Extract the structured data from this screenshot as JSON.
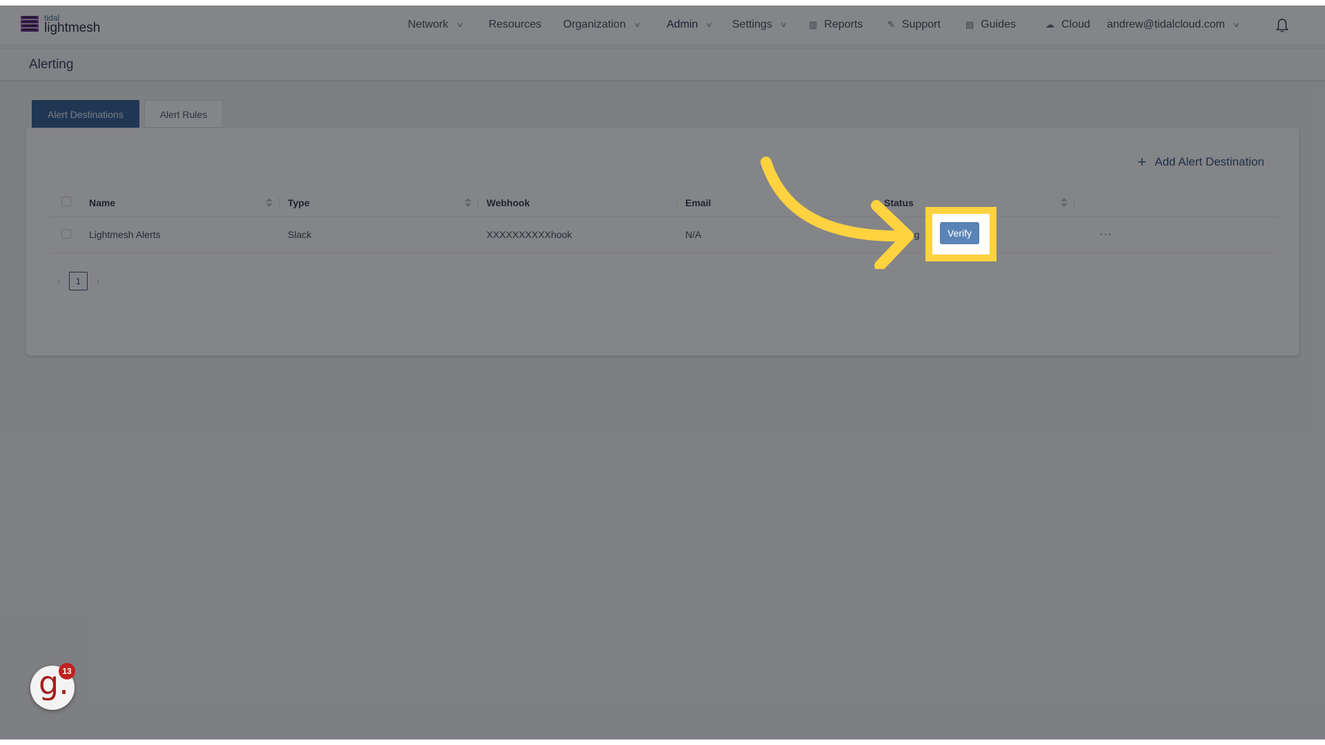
{
  "brand": {
    "top": "tidal",
    "name": "lightmesh"
  },
  "nav": {
    "items": [
      {
        "label": "Network",
        "dropdown": true
      },
      {
        "label": "Resources",
        "dropdown": false
      },
      {
        "label": "Organization",
        "dropdown": true
      },
      {
        "label": "Admin",
        "dropdown": true
      },
      {
        "label": "Settings",
        "dropdown": true
      },
      {
        "label": "Reports",
        "icon": "bar-chart-icon"
      },
      {
        "label": "Support",
        "icon": "wrench-icon"
      },
      {
        "label": "Guides",
        "icon": "book-icon"
      },
      {
        "label": "Cloud",
        "icon": "cloud-icon"
      }
    ],
    "user": "andrew@tidalcloud.com",
    "chevron": "v",
    "icons": {
      "reports": "▥",
      "support": "✎",
      "guides": "▤",
      "cloud": "☁"
    }
  },
  "page": {
    "title": "Alerting"
  },
  "tabs": [
    {
      "label": "Alert Destinations",
      "active": true
    },
    {
      "label": "Alert Rules",
      "active": false
    }
  ],
  "actions": {
    "add_label": "Add Alert Destination",
    "add_icon": "+"
  },
  "table": {
    "columns": [
      "Name",
      "Type",
      "Webhook",
      "Email",
      "Status"
    ],
    "rows": [
      {
        "name": "Lightmesh Alerts",
        "type": "Slack",
        "webhook": "XXXXXXXXXXhook",
        "email": "N/A",
        "status": "Pending",
        "verify_label": "Verify",
        "more": "···"
      }
    ]
  },
  "pagination": {
    "current": "1",
    "prev": "‹",
    "next": "›"
  },
  "highlight": {
    "target": "Verify",
    "color": "#ffd23f"
  },
  "widget": {
    "glyph": "g.",
    "badge": "13"
  },
  "colors": {
    "accent": "#2f5c93",
    "verify": "#5b84b6",
    "highlight": "#ffd23f",
    "widget": "#a3201f"
  }
}
